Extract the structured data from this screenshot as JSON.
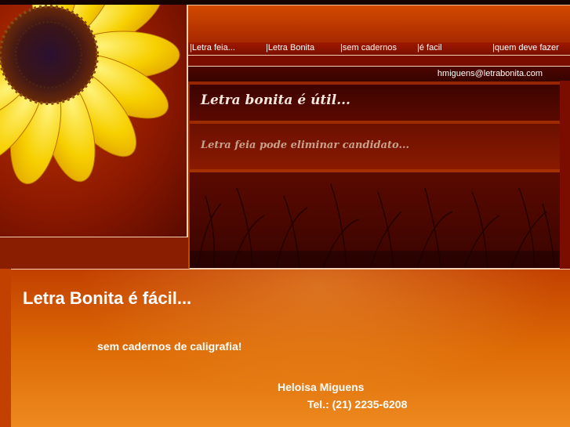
{
  "nav": {
    "items": [
      {
        "label": "|Letra feia..."
      },
      {
        "label": "|Letra Bonita"
      },
      {
        "label": "|sem cadernos"
      },
      {
        "label": "|é facil"
      },
      {
        "label": "|quem deve fazer"
      }
    ]
  },
  "header": {
    "email": "hmiguens@letrabonita.com"
  },
  "panels": {
    "util": "Letra bonita é útil...",
    "feia": "Letra feia pode eliminar candidato..."
  },
  "content": {
    "headline": "Letra Bonita é fácil...",
    "subline": "sem cadernos de caligrafia!",
    "contact_name": "Heloisa Miguens",
    "contact_phone": "Tel.: (21) 2235-6208"
  },
  "icons": {
    "banner_image": "sunflower-image",
    "grass_image": "grass-silhouette-image"
  },
  "colors": {
    "accent_orange": "#e77f10",
    "dark_red": "#5a0900",
    "petal_yellow": "#f7d000"
  }
}
